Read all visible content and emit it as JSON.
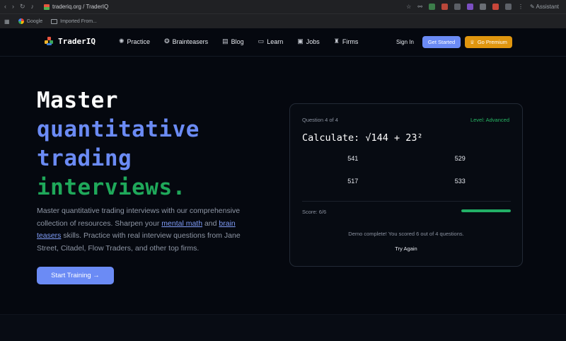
{
  "browser": {
    "url": "traderiq.org / TraderIQ",
    "assistant_label": "Assistant",
    "bookmarks": [
      {
        "label": "Google"
      },
      {
        "label": "Imported From..."
      }
    ]
  },
  "nav": {
    "brand": "TraderIQ",
    "links": [
      {
        "label": "Practice",
        "icon": "brain-icon"
      },
      {
        "label": "Brainteasers",
        "icon": "puzzle-icon"
      },
      {
        "label": "Blog",
        "icon": "newspaper-icon"
      },
      {
        "label": "Learn",
        "icon": "book-icon"
      },
      {
        "label": "Jobs",
        "icon": "briefcase-icon"
      },
      {
        "label": "Firms",
        "icon": "building-icon"
      }
    ],
    "sign_in": "Sign In",
    "get_started": "Get Started",
    "go_premium": "Go Premium"
  },
  "hero": {
    "title_line1": "Master",
    "title_line2": "quantitative",
    "title_line3": "trading",
    "title_line4": "interviews.",
    "desc_part1": "Master quantitative trading interviews with our comprehensive collection of resources. Sharpen your ",
    "link_mental_math": "mental math",
    "desc_part2": " and ",
    "link_brain_teasers": "brain teasers",
    "desc_part3": " skills. Practice with real interview questions from Jane Street, Citadel, Flow Traders, and other top firms.",
    "cta": "Start Training →"
  },
  "quiz": {
    "question_count": "Question 4 of 4",
    "level": "Level: Advanced",
    "question": "Calculate: √144 + 23²",
    "options": [
      "541",
      "529",
      "517",
      "533"
    ],
    "score": "Score: 6/6",
    "progress": 1.0,
    "demo_message": "Demo complete! You scored 6 out of 4 questions.",
    "try_again": "Try Again"
  },
  "colors": {
    "accent_blue": "#6b8bf5",
    "accent_green": "#1fa85a",
    "premium_orange": "#e0960f",
    "background": "#05080f"
  }
}
